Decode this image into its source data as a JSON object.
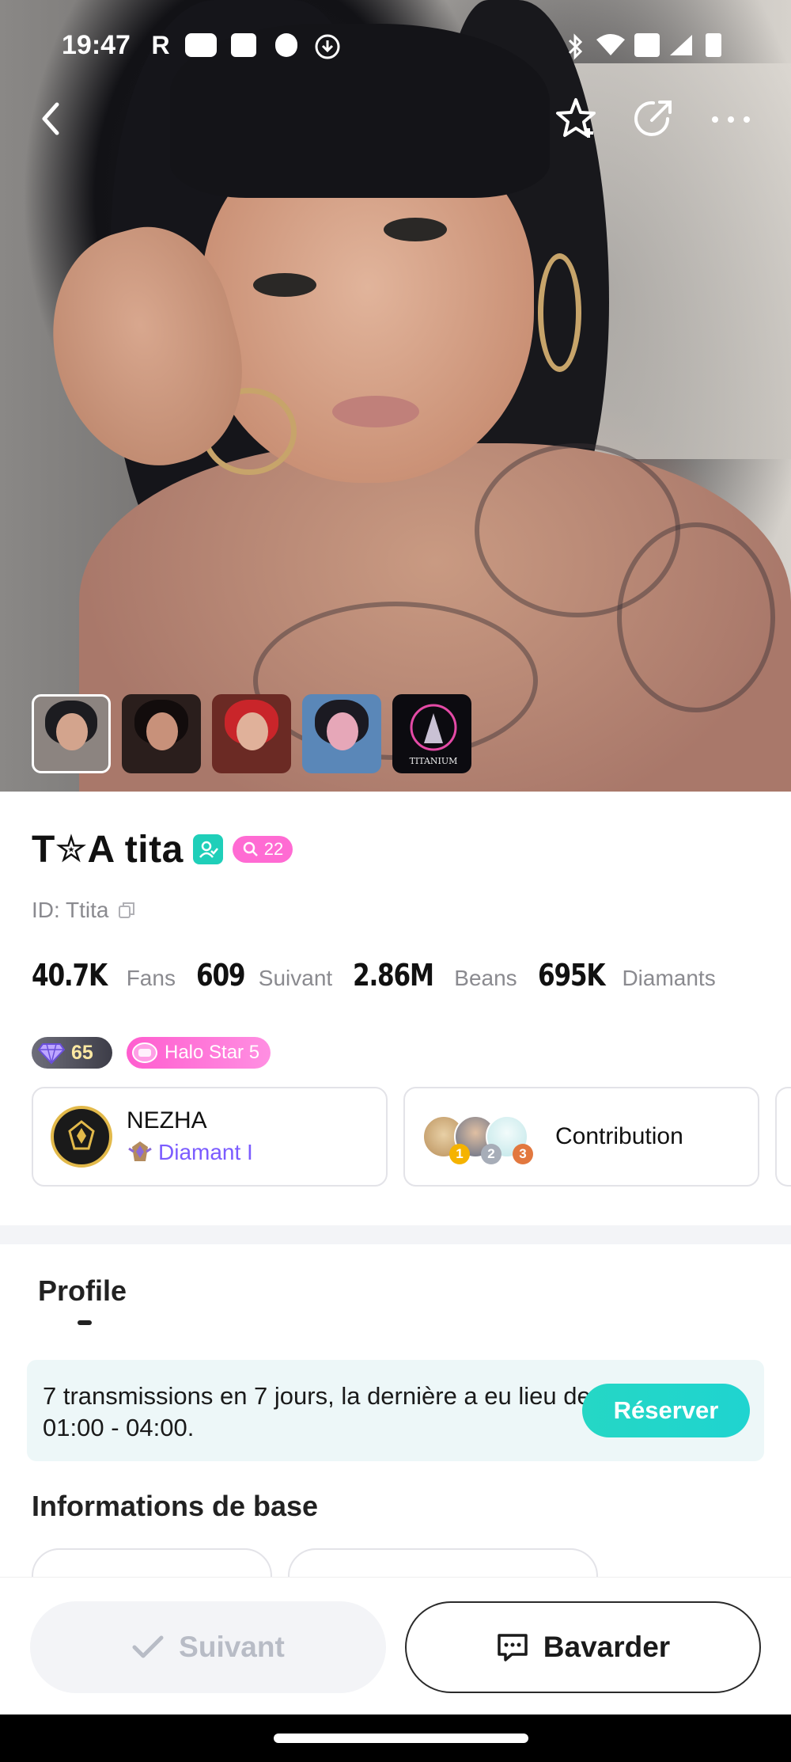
{
  "status_bar": {
    "time": "19:47",
    "icons": [
      "r-app-icon",
      "youtube-icon",
      "uniqlo-icon",
      "cloud-icon",
      "download-icon",
      "bluetooth-icon",
      "wifi-icon",
      "volte-icon",
      "signal-icon",
      "battery-icon"
    ]
  },
  "top_bar": {
    "icons": [
      "back-icon",
      "star-add-icon",
      "share-icon",
      "more-icon"
    ]
  },
  "gallery": {
    "thumbnails": [
      {
        "name": "photo-1",
        "selected": true
      },
      {
        "name": "photo-2",
        "selected": false
      },
      {
        "name": "photo-3",
        "selected": false
      },
      {
        "name": "photo-4",
        "selected": false
      },
      {
        "name": "photo-5",
        "selected": false,
        "caption": "TITANIUM"
      }
    ]
  },
  "profile": {
    "name": "T✮A tita",
    "level": "22",
    "id_label": "ID: Ttita",
    "stats": [
      {
        "value": "40.7K",
        "label": "Fans"
      },
      {
        "value": "609",
        "label": "Suivant"
      },
      {
        "value": "2.86M",
        "label": "Beans"
      },
      {
        "value": "695K",
        "label": "Diamants"
      }
    ],
    "diamond_level": "65",
    "halo_badge": "Halo Star 5"
  },
  "cards": {
    "agency": {
      "name": "NEZHA",
      "tier": "Diamant I"
    },
    "contribution": {
      "label": "Contribution",
      "ranks": [
        "1",
        "2",
        "3"
      ]
    }
  },
  "tabs": {
    "profile": "Profile"
  },
  "notice": {
    "text": "7 transmissions en 7 jours, la dernière a eu lieu de 01:00 - 04:00.",
    "button": "Réserver"
  },
  "basic_info": {
    "title": "Informations de base"
  },
  "actions": {
    "follow": "Suivant",
    "chat": "Bavarder"
  },
  "colors": {
    "accent_teal": "#1fd4c8",
    "pink": "#ff6bd3",
    "purple": "#7b5cff"
  }
}
